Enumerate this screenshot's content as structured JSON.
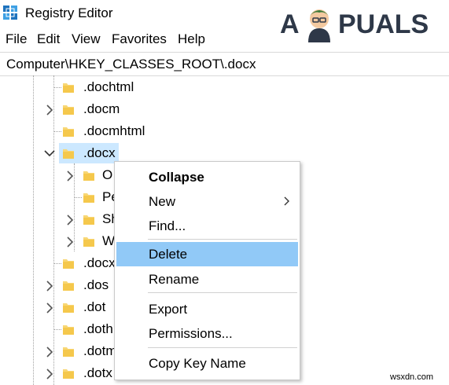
{
  "window": {
    "title": "Registry Editor"
  },
  "menu": [
    "File",
    "Edit",
    "View",
    "Favorites",
    "Help"
  ],
  "address": "Computer\\HKEY_CLASSES_ROOT\\.docx",
  "logo": {
    "text_a": "A",
    "text_rest": "PUALS"
  },
  "tree": {
    "items": [
      {
        "label": ".dochtml"
      },
      {
        "label": ".docm"
      },
      {
        "label": ".docmhtml"
      },
      {
        "label": ".docx"
      },
      {
        "label": "O"
      },
      {
        "label": "Pe"
      },
      {
        "label": "Sh"
      },
      {
        "label": "W"
      },
      {
        "label": ".docx"
      },
      {
        "label": ".dos"
      },
      {
        "label": ".dot"
      },
      {
        "label": ".doth"
      },
      {
        "label": ".dotm"
      },
      {
        "label": ".dotx"
      }
    ]
  },
  "context_menu": {
    "items": [
      "Collapse",
      "New",
      "Find...",
      "Delete",
      "Rename",
      "Export",
      "Permissions...",
      "Copy Key Name"
    ],
    "highlighted": "Delete"
  },
  "watermark": "wsxdn.com",
  "colors": {
    "selection": "#cce8ff",
    "menu_highlight": "#91c9f7",
    "folder": "#f8d775",
    "logo": "#2e3848"
  }
}
